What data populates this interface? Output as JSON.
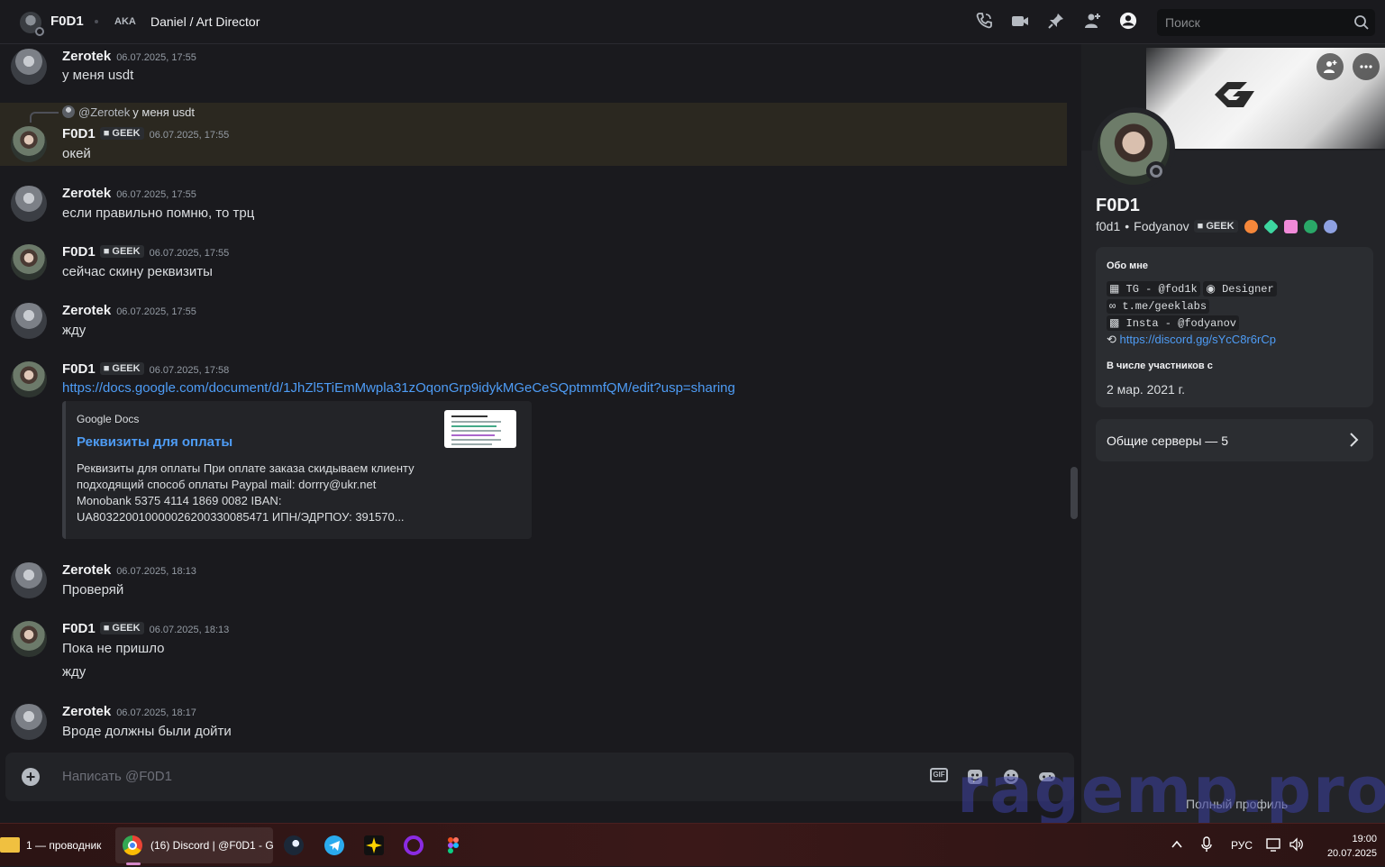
{
  "header": {
    "name": "F0D1",
    "aka": "AKA",
    "aka_name": "Daniel / Art Director",
    "search_placeholder": "Поиск",
    "icons": [
      "phone-call-icon",
      "video-icon",
      "pin-icon",
      "add-friend-icon",
      "user-profile-icon"
    ]
  },
  "messages": [
    {
      "author": "Zerotek",
      "ts": "06.07.2025, 17:55",
      "text": "у меня usdt"
    },
    {
      "reply_name": "@Zerotek",
      "reply_text": "у меня usdt",
      "author": "F0D1",
      "tag": "GEEK",
      "ts": "06.07.2025, 17:55",
      "text": "окей"
    },
    {
      "author": "Zerotek",
      "ts": "06.07.2025, 17:55",
      "text": "если правильно помню, то трц"
    },
    {
      "author": "F0D1",
      "tag": "GEEK",
      "ts": "06.07.2025, 17:55",
      "text": "сейчас скину реквизиты"
    },
    {
      "author": "Zerotek",
      "ts": "06.07.2025, 17:55",
      "text": "жду"
    },
    {
      "author": "F0D1",
      "tag": "GEEK",
      "ts": "06.07.2025, 17:58",
      "text": "https://docs.google.com/document/d/1JhZl5TiEmMwpla31zOqonGrp9idykMGeCeSQptmmfQM/edit?usp=sharing"
    },
    {
      "author": "Zerotek",
      "ts": "06.07.2025, 18:13",
      "text": "Проверяй"
    },
    {
      "author": "F0D1",
      "tag": "GEEK",
      "ts": "06.07.2025, 18:13",
      "text": "Пока не пришло",
      "text2": "жду"
    },
    {
      "author": "Zerotek",
      "ts": "06.07.2025, 18:17",
      "text": "Вроде должны были дойти"
    }
  ],
  "embed": {
    "provider": "Google Docs",
    "title": "Реквизиты для оплаты",
    "description": "Реквизиты для оплаты При оплате заказа скидываем клиенту подходящий способ оплаты Paypal mail: dorrry@ukr.net Monobank 5375 4114 1869 0082 IBAN: UA803220010000026200330085471 ИПН/ЭДРПОУ: 391570..."
  },
  "composer": {
    "placeholder": "Написать @F0D1",
    "gif_label": "GIF"
  },
  "profile": {
    "name": "F0D1",
    "username": "f0d1",
    "display_name": "Fodyanov",
    "tag": "GEEK",
    "about_heading": "Обо мне",
    "about_tg": "TG - @fod1k",
    "about_role": "Designer",
    "about_link": "t.me/geeklabs",
    "about_insta": "Insta - @fodyanov",
    "about_discord": "https://discord.gg/sYcC8r6rCp",
    "member_heading": "В числе участников с",
    "member_date": "2 мар. 2021 г.",
    "servers_label": "Общие серверы — 5",
    "full_profile": "Полный профиль"
  },
  "watermark": "ragemp.pro",
  "taskbar": {
    "explorer": "1 — проводник",
    "chrome": "(16) Discord | @F0D1 - G",
    "lang": "РУС",
    "time": "19:00",
    "date": "20.07.2025"
  },
  "colors": {
    "link": "#4e9cf5",
    "background": "#1a1a1e",
    "highlight": "#2b2820"
  }
}
